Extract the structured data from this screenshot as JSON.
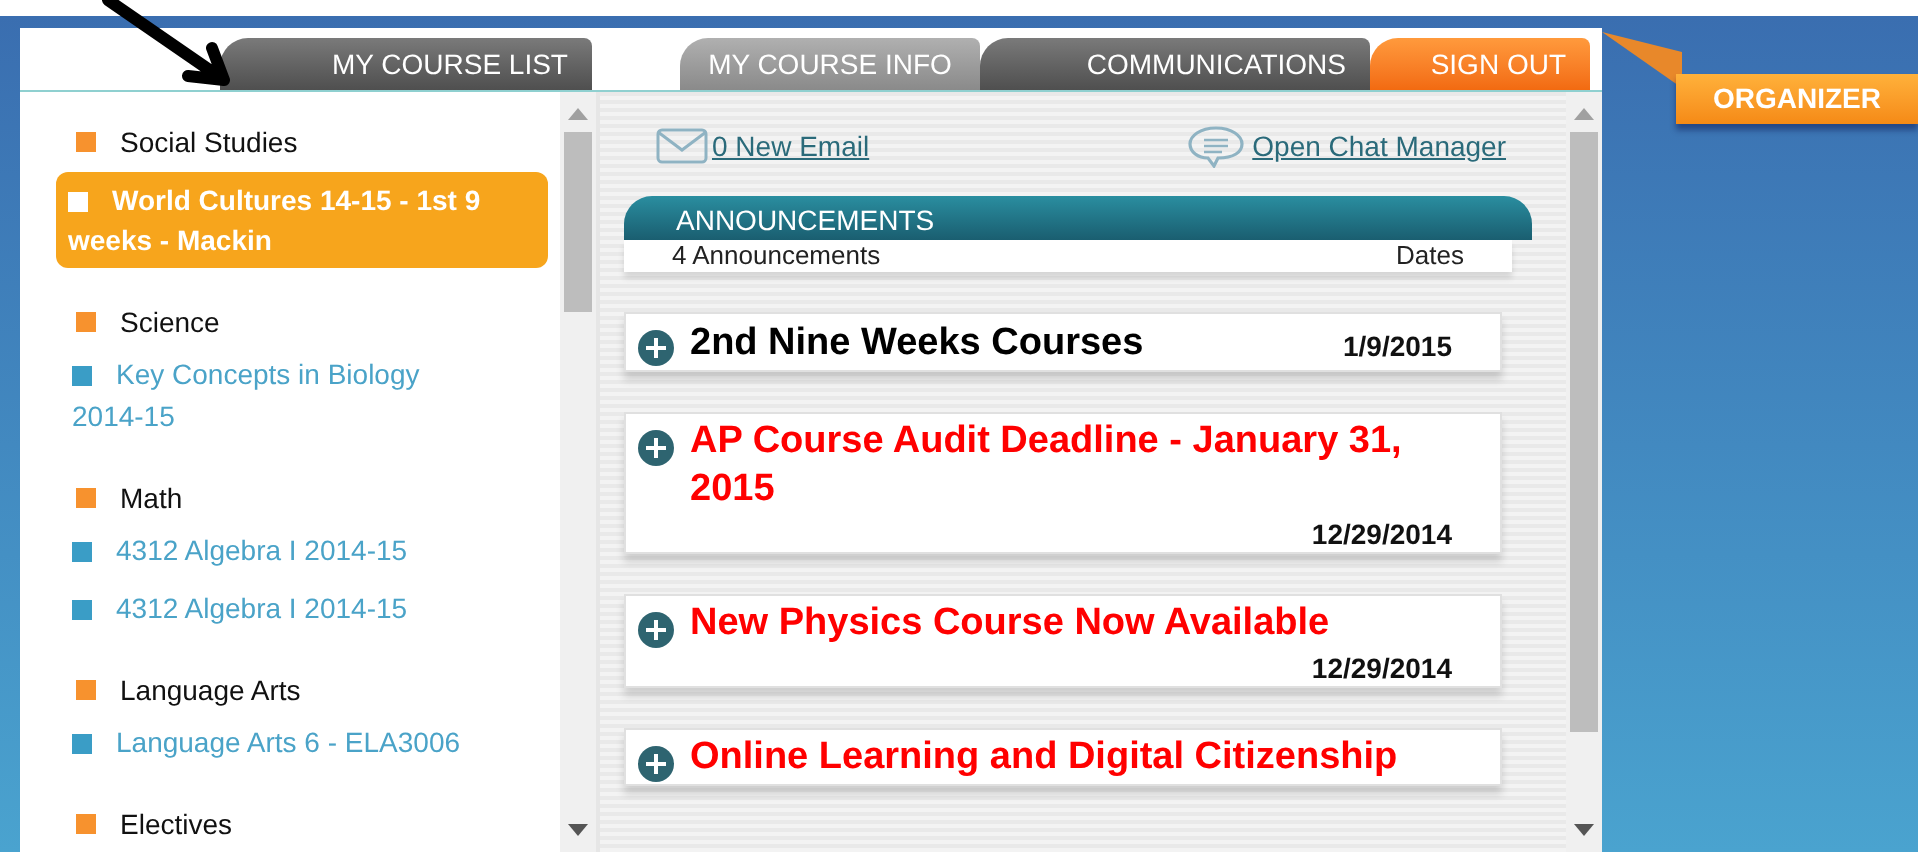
{
  "tabs": [
    {
      "label": "MY COURSE LIST",
      "kind": "tab",
      "selected": false
    },
    {
      "label": "MY COURSE INFO",
      "kind": "tab",
      "selected": true
    },
    {
      "label": "COMMUNICATIONS",
      "kind": "tab",
      "selected": false
    },
    {
      "label": "SIGN OUT",
      "kind": "action"
    }
  ],
  "organizer": {
    "label": "ORGANIZER"
  },
  "course_list": [
    {
      "name": "Social Studies",
      "children": [
        {
          "name": "World Cultures 14-15 - 1st 9 weeks - Mackin",
          "selected": true
        }
      ]
    },
    {
      "name": "Science",
      "children": [
        {
          "name": "Key Concepts in Biology 2014-15",
          "selected": false
        }
      ]
    },
    {
      "name": "Math",
      "children": [
        {
          "name": "4312 Algebra I 2014-15",
          "selected": false
        },
        {
          "name": "4312 Algebra I 2014-15",
          "selected": false
        }
      ]
    },
    {
      "name": "Language Arts",
      "children": [
        {
          "name": "Language Arts 6 - ELA3006",
          "selected": false
        }
      ]
    },
    {
      "name": "Electives"
    }
  ],
  "links": {
    "email": "0 New Email",
    "chat": "Open Chat Manager"
  },
  "announcements": {
    "title": "ANNOUNCEMENTS",
    "count": "4 Announcements",
    "dates_header": "Dates",
    "items": [
      {
        "title": "2nd Nine Weeks Courses",
        "date": "1/9/2015",
        "kind": "normal"
      },
      {
        "title": "AP Course Audit Deadline - January 31, 2015",
        "date": "12/29/2014",
        "kind": "urgent"
      },
      {
        "title": "New Physics Course Now Available",
        "date": "12/29/2014",
        "kind": "urgent"
      },
      {
        "title": "Online Learning and Digital Citizenship",
        "kind": "urgent"
      }
    ]
  }
}
